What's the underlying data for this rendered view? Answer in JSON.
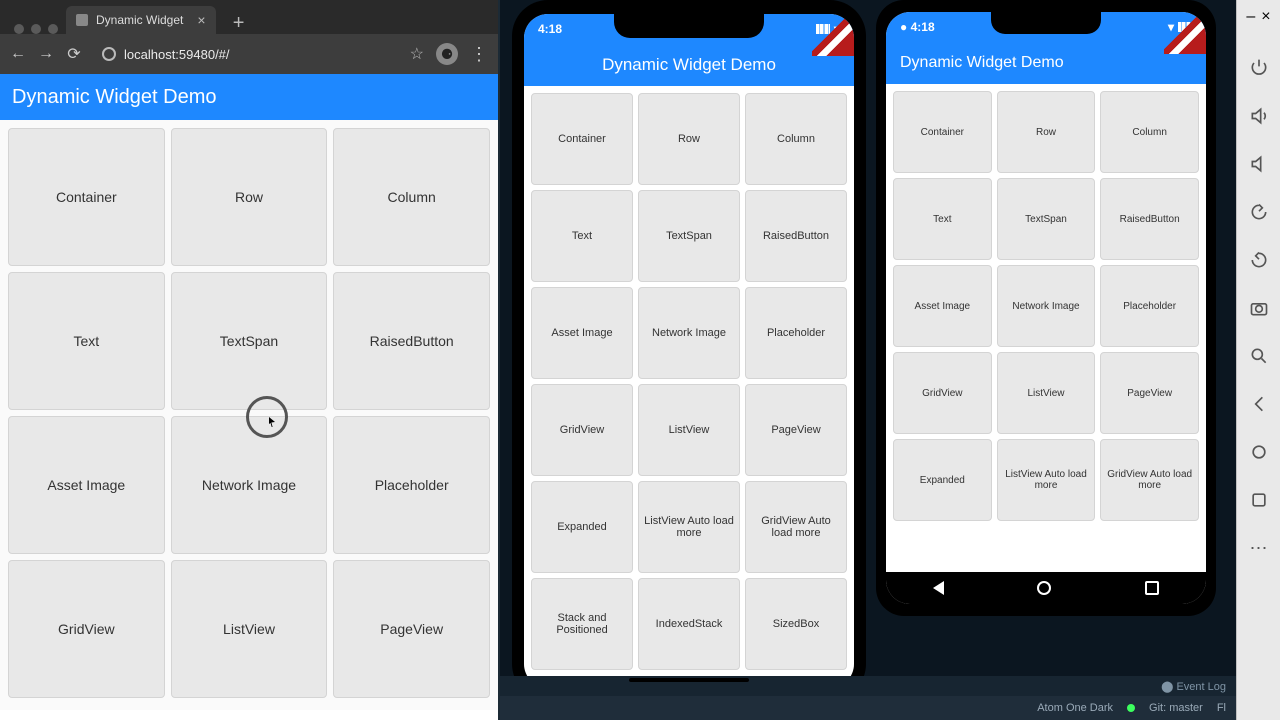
{
  "browser": {
    "tab_title": "Dynamic Widget",
    "url_text": "localhost:59480/#/",
    "appbar_title": "Dynamic Widget Demo"
  },
  "widgets_web": [
    "Container",
    "Row",
    "Column",
    "Text",
    "TextSpan",
    "RaisedButton",
    "Asset Image",
    "Network Image",
    "Placeholder",
    "GridView",
    "ListView",
    "PageView"
  ],
  "ios": {
    "time": "4:18",
    "appbar_title": "Dynamic Widget Demo",
    "widgets": [
      "Container",
      "Row",
      "Column",
      "Text",
      "TextSpan",
      "RaisedButton",
      "Asset Image",
      "Network Image",
      "Placeholder",
      "GridView",
      "ListView",
      "PageView",
      "Expanded",
      "ListView Auto load more",
      "GridView Auto load more",
      "Stack and Positioned",
      "IndexedStack",
      "SizedBox"
    ]
  },
  "android": {
    "time": "4:18",
    "appbar_title": "Dynamic Widget Demo",
    "widgets": [
      "Container",
      "Row",
      "Column",
      "Text",
      "TextSpan",
      "RaisedButton",
      "Asset Image",
      "Network Image",
      "Placeholder",
      "GridView",
      "ListView",
      "PageView",
      "Expanded",
      "ListView Auto load more",
      "GridView Auto load more"
    ]
  },
  "ide": {
    "event_log": "Event Log",
    "git": "Git: master",
    "encoding": "Atom One Dark",
    "flutter_label": "Fl"
  },
  "dev_toolbar_icons": [
    "power-icon",
    "volume-up-icon",
    "volume-down-icon",
    "rotate-left-icon",
    "rotate-right-icon",
    "camera-icon",
    "zoom-icon",
    "back-icon",
    "home-icon",
    "overview-icon",
    "more-icon"
  ]
}
